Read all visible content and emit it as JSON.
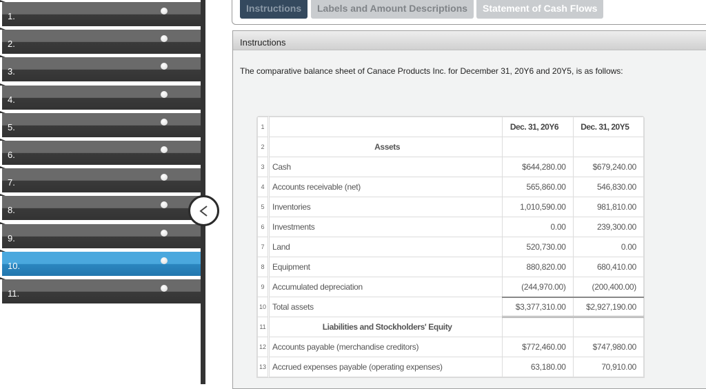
{
  "sidebar": {
    "items": [
      {
        "label": "1.",
        "active": false
      },
      {
        "label": "2.",
        "active": false
      },
      {
        "label": "3.",
        "active": false
      },
      {
        "label": "4.",
        "active": false
      },
      {
        "label": "5.",
        "active": false
      },
      {
        "label": "6.",
        "active": false
      },
      {
        "label": "7.",
        "active": false
      },
      {
        "label": "8.",
        "active": false
      },
      {
        "label": "9.",
        "active": false
      },
      {
        "label": "10.",
        "active": true
      },
      {
        "label": "11.",
        "active": false
      }
    ],
    "collapse_icon": "chevron-left-icon"
  },
  "tabs": [
    {
      "label": "Instructions",
      "active": true
    },
    {
      "label": "Labels and Amount Descriptions",
      "active": false
    },
    {
      "label": "Statement of Cash Flows",
      "active": false
    }
  ],
  "panel": {
    "title": "Instructions",
    "intro": "The comparative balance sheet of Canace Products Inc. for December 31, 20Y6 and 20Y5, is as follows:"
  },
  "sheet": {
    "columns": [
      "",
      "Dec. 31, 20Y6",
      "Dec. 31, 20Y5"
    ],
    "rows": [
      {
        "n": "1",
        "label": "",
        "type": "colhead",
        "y6": "Dec. 31, 20Y6",
        "y5": "Dec. 31, 20Y5"
      },
      {
        "n": "2",
        "label": "Assets",
        "type": "heading",
        "y6": "",
        "y5": ""
      },
      {
        "n": "3",
        "label": "Cash",
        "type": "line",
        "y6": "$644,280.00",
        "y5": "$679,240.00"
      },
      {
        "n": "4",
        "label": "Accounts receivable (net)",
        "type": "line",
        "y6": "565,860.00",
        "y5": "546,830.00"
      },
      {
        "n": "5",
        "label": "Inventories",
        "type": "line",
        "y6": "1,010,590.00",
        "y5": "981,810.00"
      },
      {
        "n": "6",
        "label": "Investments",
        "type": "line",
        "y6": "0.00",
        "y5": "239,300.00"
      },
      {
        "n": "7",
        "label": "Land",
        "type": "line",
        "y6": "520,730.00",
        "y5": "0.00"
      },
      {
        "n": "8",
        "label": "Equipment",
        "type": "line",
        "y6": "880,820.00",
        "y5": "680,410.00"
      },
      {
        "n": "9",
        "label": "Accumulated depreciation",
        "type": "line",
        "y6": "(244,970.00)",
        "y5": "(200,400.00)"
      },
      {
        "n": "10",
        "label": "Total assets",
        "type": "total",
        "y6": "$3,377,310.00",
        "y5": "$2,927,190.00"
      },
      {
        "n": "11",
        "label": "Liabilities and Stockholders' Equity",
        "type": "heading",
        "y6": "",
        "y5": ""
      },
      {
        "n": "12",
        "label": "Accounts payable (merchandise creditors)",
        "type": "line",
        "y6": "$772,460.00",
        "y5": "$747,980.00"
      },
      {
        "n": "13",
        "label": "Accrued expenses payable (operating expenses)",
        "type": "line",
        "y6": "63,180.00",
        "y5": "70,910.00"
      }
    ]
  },
  "colors": {
    "active_nav": "#2b86c0",
    "nav": "#333333",
    "active_tab": "#34495e",
    "inactive_tab": "#c9cccf"
  }
}
